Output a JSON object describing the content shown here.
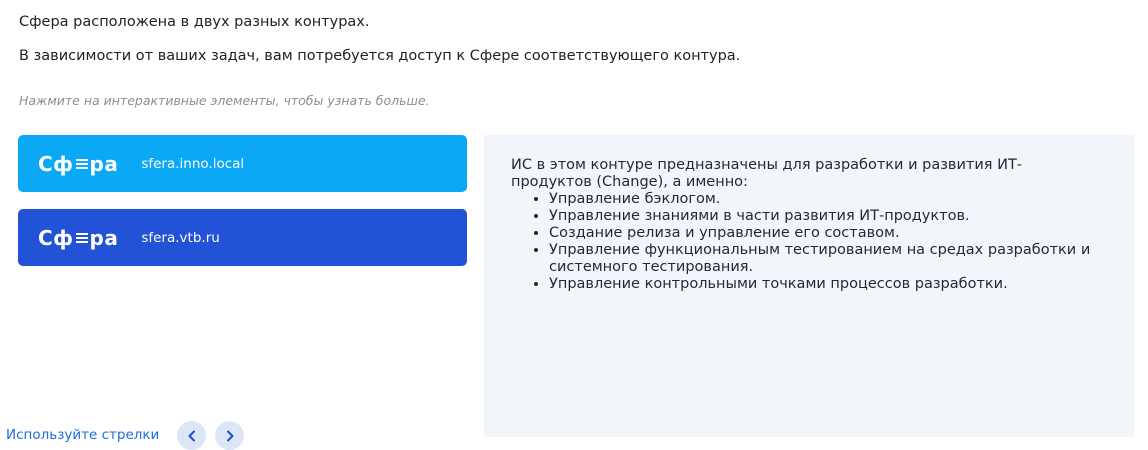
{
  "intro": {
    "line1": "Сфера расположена в двух разных контурах.",
    "line2": "В зависимости от ваших задач, вам потребуется доступ к Сфере соответствующего контура.",
    "hint": "Нажмите на интерактивные элементы, чтобы узнать больше."
  },
  "cards": [
    {
      "logo_left": "Сф",
      "logo_right": "ра",
      "domain": "sfera.inno.local",
      "color": "#0aa8f5"
    },
    {
      "logo_left": "Сф",
      "logo_right": "ра",
      "domain": "sfera.vtb.ru",
      "color": "#2252d6"
    }
  ],
  "panel": {
    "lead": "ИС в этом контуре предназначены для разработки и развития ИТ-продуктов (Change), а именно:",
    "items": [
      "Управление бэклогом.",
      "Управление знаниями в части развития ИТ-продуктов.",
      "Создание релиза и управление его составом.",
      "Управление функциональным тестированием на средах разработки и системного тестирования.",
      "Управление контрольными точками процессов разработки."
    ],
    "background": "#f2f5f9"
  },
  "navigation": {
    "label": "Используйте стрелки",
    "prev_icon": "chevron-left-icon",
    "next_icon": "chevron-right-icon"
  }
}
